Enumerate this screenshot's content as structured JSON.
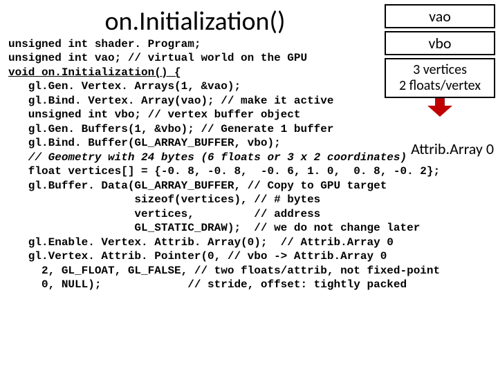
{
  "title": "on.Initialization()",
  "diagram": {
    "vao": "vao",
    "vbo": "vbo",
    "vert1": "3 vertices",
    "vert2": "2 floats/vertex",
    "attrib": "Attrib.Array 0"
  },
  "code": {
    "l01": "unsigned int shader. Program;",
    "l02": "unsigned int vao; // virtual world on the GPU",
    "l03": "void on.Initialization() {",
    "l04": "   gl.Gen. Vertex. Arrays(1, &vao);",
    "l05": "   gl.Bind. Vertex. Array(vao); // make it active",
    "l06": "   unsigned int vbo; // vertex buffer object",
    "l07": "   gl.Gen. Buffers(1, &vbo); // Generate 1 buffer",
    "l08": "   gl.Bind. Buffer(GL_ARRAY_BUFFER, vbo);",
    "l09": "   // Geometry with 24 bytes (6 floats or 3 x 2 coordinates)",
    "l10": "   float vertices[] = {-0. 8, -0. 8,  -0. 6, 1. 0,  0. 8, -0. 2};",
    "l11": "   gl.Buffer. Data(GL_ARRAY_BUFFER, // Copy to GPU target",
    "l12": "                   sizeof(vertices), // # bytes",
    "l13": "                   vertices,         // address",
    "l14": "                   GL_STATIC_DRAW);  // we do not change later",
    "l15": "   gl.Enable. Vertex. Attrib. Array(0);  // Attrib.Array 0",
    "l16": "   gl.Vertex. Attrib. Pointer(0, // vbo -> Attrib.Array 0",
    "l17": "     2, GL_FLOAT, GL_FALSE, // two floats/attrib, not fixed-point",
    "l18": "     0, NULL);             // stride, offset: tightly packed"
  }
}
